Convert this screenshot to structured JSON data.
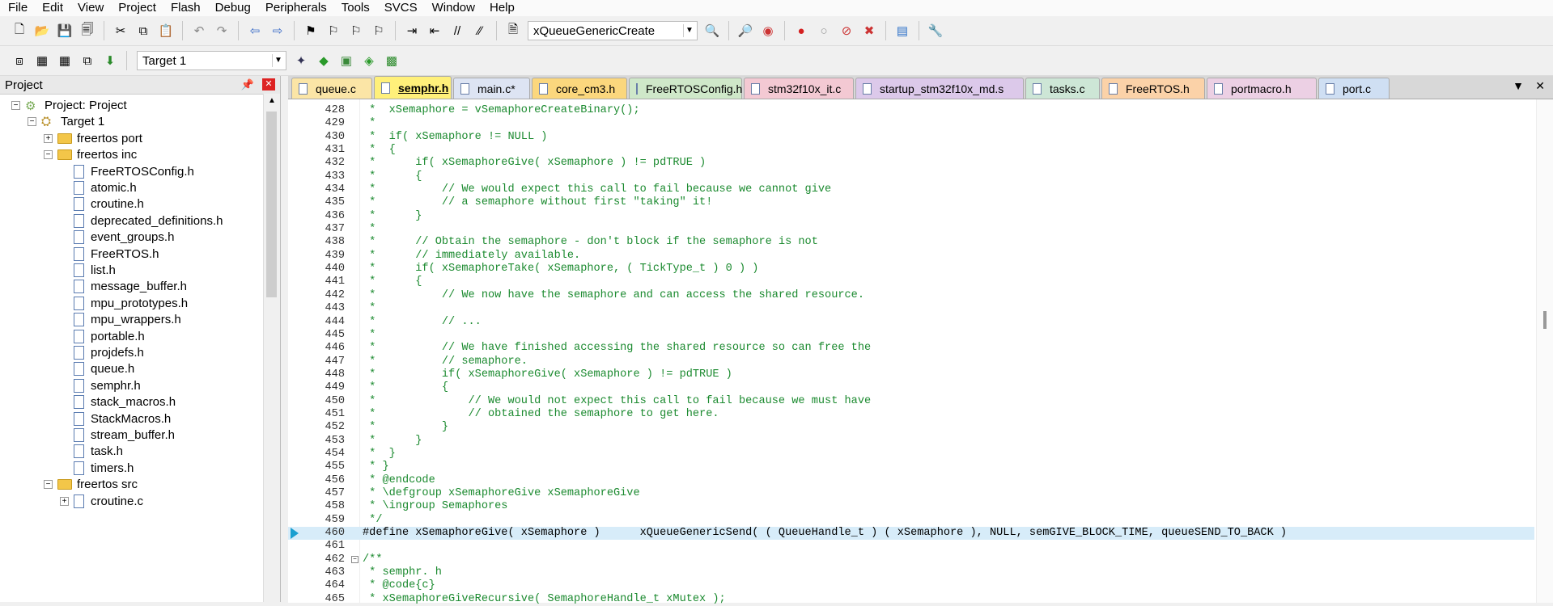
{
  "menu": [
    "File",
    "Edit",
    "View",
    "Project",
    "Flash",
    "Debug",
    "Peripherals",
    "Tools",
    "SVCS",
    "Window",
    "Help"
  ],
  "toolbar1": {
    "icons": [
      "new-file-icon",
      "open-file-icon",
      "save-icon",
      "save-all-icon",
      "cut-icon",
      "copy-icon",
      "paste-icon",
      "undo-icon",
      "redo-icon",
      "nav-back-icon",
      "nav-forward-icon",
      "bookmark-icon",
      "bookmark-prev-icon",
      "bookmark-next-icon",
      "bookmark-clear-icon",
      "indent-icon",
      "unindent-icon",
      "comment-icon",
      "uncomment-icon",
      "find-in-files-icon"
    ],
    "find_value": "xQueueGenericCreate",
    "icons2": [
      "find-icon",
      "incremental-find-icon",
      "debug-session-icon",
      "breakpoint-insert-icon",
      "breakpoint-enable-icon",
      "breakpoint-disable-icon",
      "breakpoint-kill-icon",
      "window-layout-icon",
      "configure-icon"
    ]
  },
  "toolbar2": {
    "target": "Target 1",
    "icons": [
      "translate-icon",
      "build-icon",
      "rebuild-icon",
      "batch-build-icon",
      "download-icon",
      "target-options-icon",
      "manage-components-icon",
      "pack-installer-icon",
      "select-software-packs-icon",
      "manage-runtime-icon"
    ]
  },
  "project_panel": {
    "title": "Project",
    "tree": [
      {
        "label": "Project: Project",
        "kind": "project",
        "level": 0,
        "expander": "-"
      },
      {
        "label": "Target 1",
        "kind": "target",
        "level": 1,
        "expander": "-"
      },
      {
        "label": "freertos port",
        "kind": "folder",
        "level": 2,
        "expander": "+"
      },
      {
        "label": "freertos inc",
        "kind": "folder",
        "level": 2,
        "expander": "-"
      },
      {
        "label": "FreeRTOSConfig.h",
        "kind": "file",
        "level": 3
      },
      {
        "label": "atomic.h",
        "kind": "file",
        "level": 3
      },
      {
        "label": "croutine.h",
        "kind": "file",
        "level": 3
      },
      {
        "label": "deprecated_definitions.h",
        "kind": "file",
        "level": 3
      },
      {
        "label": "event_groups.h",
        "kind": "file",
        "level": 3
      },
      {
        "label": "FreeRTOS.h",
        "kind": "file",
        "level": 3
      },
      {
        "label": "list.h",
        "kind": "file",
        "level": 3
      },
      {
        "label": "message_buffer.h",
        "kind": "file",
        "level": 3
      },
      {
        "label": "mpu_prototypes.h",
        "kind": "file",
        "level": 3
      },
      {
        "label": "mpu_wrappers.h",
        "kind": "file",
        "level": 3
      },
      {
        "label": "portable.h",
        "kind": "file",
        "level": 3
      },
      {
        "label": "projdefs.h",
        "kind": "file",
        "level": 3
      },
      {
        "label": "queue.h",
        "kind": "file",
        "level": 3
      },
      {
        "label": "semphr.h",
        "kind": "file",
        "level": 3
      },
      {
        "label": "stack_macros.h",
        "kind": "file",
        "level": 3
      },
      {
        "label": "StackMacros.h",
        "kind": "file",
        "level": 3
      },
      {
        "label": "stream_buffer.h",
        "kind": "file",
        "level": 3
      },
      {
        "label": "task.h",
        "kind": "file",
        "level": 3
      },
      {
        "label": "timers.h",
        "kind": "file",
        "level": 3
      },
      {
        "label": "freertos src",
        "kind": "folder",
        "level": 2,
        "expander": "-"
      },
      {
        "label": "croutine.c",
        "kind": "file",
        "level": 3,
        "expander": "+"
      }
    ]
  },
  "tabs": [
    {
      "label": "queue.c",
      "color": "#fbe5a6",
      "active": false
    },
    {
      "label": "semphr.h",
      "color": "#fff07a",
      "active": true
    },
    {
      "label": "main.c*",
      "color": "#dde4f3",
      "active": false
    },
    {
      "label": "core_cm3.h",
      "color": "#fbd77d",
      "active": false
    },
    {
      "label": "FreeRTOSConfig.h",
      "color": "#cfe8c9",
      "active": false
    },
    {
      "label": "stm32f10x_it.c",
      "color": "#f3c9d3",
      "active": false
    },
    {
      "label": "startup_stm32f10x_md.s",
      "color": "#dcc9ea",
      "active": false
    },
    {
      "label": "tasks.c",
      "color": "#cde6d6",
      "active": false
    },
    {
      "label": "FreeRTOS.h",
      "color": "#fbd2a8",
      "active": false
    },
    {
      "label": "portmacro.h",
      "color": "#ecd0e4",
      "active": false
    },
    {
      "label": "port.c",
      "color": "#cfdff3",
      "active": false
    }
  ],
  "code_lines": [
    {
      "n": "428",
      "t": " *  xSemaphore = vSemaphoreCreateBinary();"
    },
    {
      "n": "429",
      "t": " *"
    },
    {
      "n": "430",
      "t": " *  if( xSemaphore != NULL )"
    },
    {
      "n": "431",
      "t": " *  {"
    },
    {
      "n": "432",
      "t": " *      if( xSemaphoreGive( xSemaphore ) != pdTRUE )"
    },
    {
      "n": "433",
      "t": " *      {"
    },
    {
      "n": "434",
      "t": " *          // We would expect this call to fail because we cannot give"
    },
    {
      "n": "435",
      "t": " *          // a semaphore without first \"taking\" it!"
    },
    {
      "n": "436",
      "t": " *      }"
    },
    {
      "n": "437",
      "t": " *"
    },
    {
      "n": "438",
      "t": " *      // Obtain the semaphore - don't block if the semaphore is not"
    },
    {
      "n": "439",
      "t": " *      // immediately available."
    },
    {
      "n": "440",
      "t": " *      if( xSemaphoreTake( xSemaphore, ( TickType_t ) 0 ) )"
    },
    {
      "n": "441",
      "t": " *      {"
    },
    {
      "n": "442",
      "t": " *          // We now have the semaphore and can access the shared resource."
    },
    {
      "n": "443",
      "t": " *"
    },
    {
      "n": "444",
      "t": " *          // ..."
    },
    {
      "n": "445",
      "t": " *"
    },
    {
      "n": "446",
      "t": " *          // We have finished accessing the shared resource so can free the"
    },
    {
      "n": "447",
      "t": " *          // semaphore."
    },
    {
      "n": "448",
      "t": " *          if( xSemaphoreGive( xSemaphore ) != pdTRUE )"
    },
    {
      "n": "449",
      "t": " *          {"
    },
    {
      "n": "450",
      "t": " *              // We would not expect this call to fail because we must have"
    },
    {
      "n": "451",
      "t": " *              // obtained the semaphore to get here."
    },
    {
      "n": "452",
      "t": " *          }"
    },
    {
      "n": "453",
      "t": " *      }"
    },
    {
      "n": "454",
      "t": " *  }"
    },
    {
      "n": "455",
      "t": " * }"
    },
    {
      "n": "456",
      "t": " * @endcode"
    },
    {
      "n": "457",
      "t": " * \\defgroup xSemaphoreGive xSemaphoreGive"
    },
    {
      "n": "458",
      "t": " * \\ingroup Semaphores"
    },
    {
      "n": "459",
      "t": " */"
    },
    {
      "n": "460",
      "t": "#define xSemaphoreGive( xSemaphore )      xQueueGenericSend( ( QueueHandle_t ) ( xSemaphore ), NULL, semGIVE_BLOCK_TIME, queueSEND_TO_BACK )",
      "pp": true,
      "hl": true,
      "marker": true
    },
    {
      "n": "461",
      "t": ""
    },
    {
      "n": "462",
      "t": "/**",
      "fold": true
    },
    {
      "n": "463",
      "t": " * semphr. h"
    },
    {
      "n": "464",
      "t": " * @code{c}"
    },
    {
      "n": "465",
      "t": " * xSemaphoreGiveRecursive( SemaphoreHandle_t xMutex );"
    }
  ]
}
